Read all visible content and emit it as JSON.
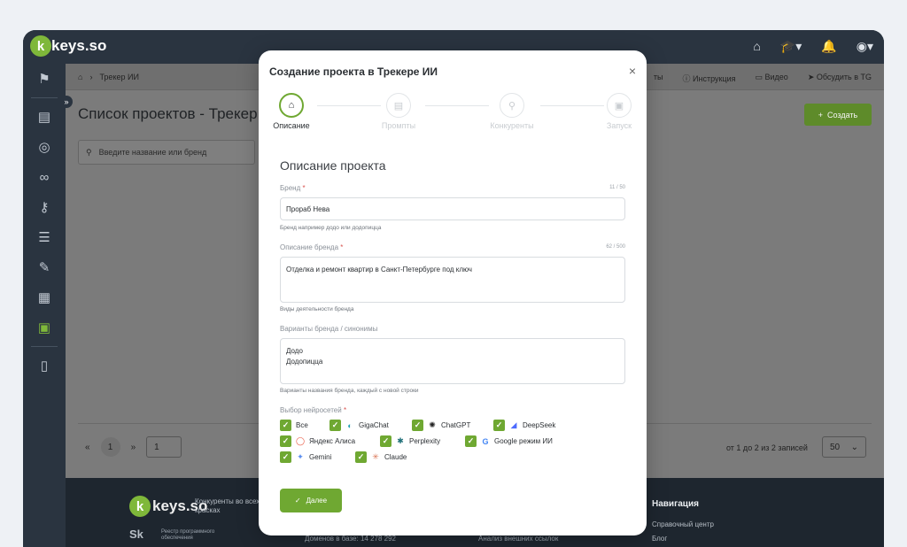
{
  "app": {
    "logo_text": "keys.so",
    "logo_letter": "k"
  },
  "breadcrumb": {
    "home_icon": "home-icon",
    "current": "Трекер ИИ"
  },
  "header_links": [
    {
      "icon": "info-icon",
      "label": "Инструкция"
    },
    {
      "icon": "video-icon",
      "label": "Видео"
    },
    {
      "icon": "send-icon",
      "label": "Обсудить в TG"
    }
  ],
  "header_links_partial": "ты",
  "page": {
    "title": "Список проектов - Трекер И",
    "create_label": "Создать",
    "search_placeholder": "Введите название или бренд"
  },
  "pagination": {
    "prev": "«",
    "current": "1",
    "next": "»",
    "goto_value": "1",
    "records": "от 1 до 2 из 2 записей",
    "per_page": "50"
  },
  "footer": {
    "logo_text": "keys.so",
    "tagline": "Конкуренты во всех красках",
    "sk_label": "Sk",
    "registry": "Реестр программного обеспечения",
    "domains": "Доменов в базе: 14 278 292",
    "analysis": "Анализ внешних ссылок",
    "nav_title": "Навигация",
    "help_center": "Справочный центр",
    "blog": "Блог"
  },
  "modal": {
    "title": "Создание проекта в Трекере ИИ",
    "close": "×",
    "steps": [
      {
        "label": "Описание",
        "icon": "home-icon",
        "active": true
      },
      {
        "label": "Промпты",
        "icon": "list-icon",
        "active": false
      },
      {
        "label": "Конкуренты",
        "icon": "search-icon",
        "active": false
      },
      {
        "label": "Запуск",
        "icon": "launch-icon",
        "active": false
      }
    ],
    "section_title": "Описание проекта",
    "brand": {
      "label": "Бренд",
      "required": "*",
      "count": "11 / 50",
      "value": "Прораб Нева",
      "help": "Бренд например додо или додопицца"
    },
    "description": {
      "label": "Описание бренда",
      "required": "*",
      "count": "62 / 500",
      "value": "Отделка и ремонт квартир в Санкт-Петербурге под ключ",
      "help": "Виды деятельности бренда"
    },
    "variants": {
      "label": "Варианты бренда / синонимы",
      "lines": [
        "Додо",
        "Додопицца"
      ],
      "help": "Варианты названия бренда, каждый с новой строки"
    },
    "networks": {
      "label": "Выбор нейросетей",
      "required": "*",
      "items": [
        {
          "label": "Все",
          "checked": true
        },
        {
          "label": "GigaChat",
          "checked": true,
          "color": "#21a0b4"
        },
        {
          "label": "ChatGPT",
          "checked": true,
          "color": "#222222"
        },
        {
          "label": "DeepSeek",
          "checked": true,
          "color": "#4d6bfe"
        },
        {
          "label": "Яндекс Алиса",
          "checked": true,
          "color": "#e8553e"
        },
        {
          "label": "Perplexity",
          "checked": true,
          "color": "#1f6f78"
        },
        {
          "label": "Google режим ИИ",
          "checked": true,
          "color": "#4285f4"
        },
        {
          "label": "Gemini",
          "checked": true,
          "color": "#5b8def"
        },
        {
          "label": "Claude",
          "checked": true,
          "color": "#d97757"
        }
      ]
    },
    "next_label": "Далее"
  },
  "colors": {
    "accent": "#6fa832",
    "sidebar": "#2a3440"
  }
}
